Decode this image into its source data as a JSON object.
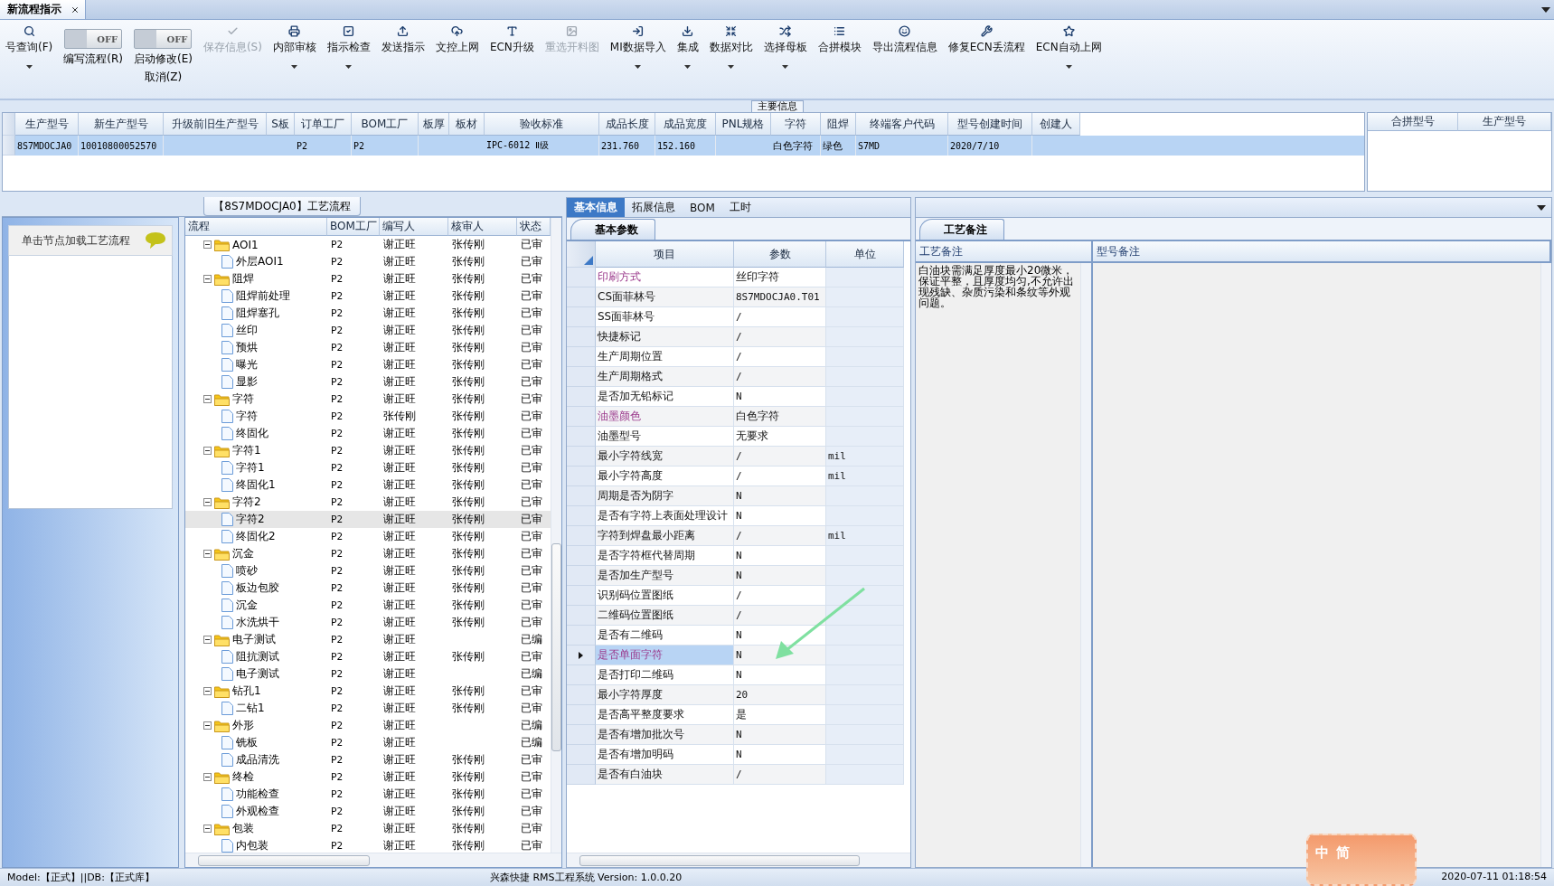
{
  "document_tabs": [
    {
      "label": "新流程指示",
      "selected": true
    }
  ],
  "toolbar": [
    {
      "kind": "button",
      "label": "号查询(F)",
      "disabled": false,
      "dropdown": true
    },
    {
      "kind": "toggle",
      "label": "编写流程(R)",
      "on": false,
      "state_text": "OFF"
    },
    {
      "kind": "toggle",
      "label": "启动修改(E)",
      "sublabel": "取消(Z)",
      "on": false,
      "state_text": "OFF"
    },
    {
      "kind": "button",
      "label": "保存信息(S)",
      "disabled": true,
      "dropdown": false
    },
    {
      "kind": "button",
      "label": "内部审核",
      "disabled": false,
      "dropdown": true
    },
    {
      "kind": "button",
      "label": "指示检查",
      "disabled": false,
      "dropdown": true
    },
    {
      "kind": "button",
      "label": "发送指示",
      "disabled": false,
      "dropdown": false
    },
    {
      "kind": "button",
      "label": "文控上网",
      "disabled": false,
      "dropdown": false
    },
    {
      "kind": "button",
      "label": "ECN升级",
      "disabled": false,
      "dropdown": false
    },
    {
      "kind": "button",
      "label": "重选开料图",
      "disabled": true,
      "dropdown": false
    },
    {
      "kind": "button",
      "label": "MI数据导入",
      "disabled": false,
      "dropdown": true
    },
    {
      "kind": "button",
      "label": "集成",
      "disabled": false,
      "dropdown": true
    },
    {
      "kind": "button",
      "label": "数据对比",
      "disabled": false,
      "dropdown": true
    },
    {
      "kind": "button",
      "label": "选择母板",
      "disabled": false,
      "dropdown": true
    },
    {
      "kind": "button",
      "label": "合拼模块",
      "disabled": false,
      "dropdown": false
    },
    {
      "kind": "button",
      "label": "导出流程信息",
      "disabled": false,
      "dropdown": false
    },
    {
      "kind": "button",
      "label": "修复ECN丢流程",
      "disabled": false,
      "dropdown": false
    },
    {
      "kind": "button",
      "label": "ECN自动上网",
      "disabled": false,
      "dropdown": true
    }
  ],
  "main_info": {
    "title": "主要信息",
    "columns": [
      "生产型号",
      "新生产型号",
      "升级前旧生产型号",
      "S板",
      "订单工厂",
      "BOM工厂",
      "板厚",
      "板材",
      "验收标准",
      "成品长度",
      "成品宽度",
      "PNL规格",
      "字符",
      "阻焊",
      "终端客户代码",
      "型号创建时间",
      "创建人"
    ],
    "rows": [
      {
        "selected": true,
        "cells": [
          "8S7MDOCJA0",
          "10010800052570",
          null,
          null,
          "P2",
          "P2",
          null,
          null,
          "IPC-6012 Ⅱ级",
          "231.760",
          "152.160",
          null,
          "白色字符",
          "绿色",
          "S7MD",
          "2020/7/10",
          null
        ]
      }
    ]
  },
  "merge_table": {
    "columns": [
      "合拼型号",
      "生产型号"
    ]
  },
  "flow_panel": {
    "title": "【8S7MDOCJA0】工艺流程",
    "hint": "单击节点加载工艺流程",
    "columns": [
      "流程",
      "BOM工厂",
      "编写人",
      "核审人",
      "状态"
    ],
    "nodes": [
      {
        "name": "AOI1",
        "factory": "P2",
        "writer": "谢正旺",
        "reviewer": "张传刚",
        "status": "已审",
        "expanded": true,
        "selected": false,
        "children": [
          {
            "name": "外层AOI1",
            "factory": "P2",
            "writer": "谢正旺",
            "reviewer": "张传刚",
            "status": "已审",
            "selected": false
          }
        ]
      },
      {
        "name": "阻焊",
        "factory": "P2",
        "writer": "谢正旺",
        "reviewer": "张传刚",
        "status": "已审",
        "expanded": true,
        "selected": false,
        "children": [
          {
            "name": "阻焊前处理",
            "factory": "P2",
            "writer": "谢正旺",
            "reviewer": "张传刚",
            "status": "已审",
            "selected": false
          },
          {
            "name": "阻焊塞孔",
            "factory": "P2",
            "writer": "谢正旺",
            "reviewer": "张传刚",
            "status": "已审",
            "selected": false
          },
          {
            "name": "丝印",
            "factory": "P2",
            "writer": "谢正旺",
            "reviewer": "张传刚",
            "status": "已审",
            "selected": false
          },
          {
            "name": "预烘",
            "factory": "P2",
            "writer": "谢正旺",
            "reviewer": "张传刚",
            "status": "已审",
            "selected": false
          },
          {
            "name": "曝光",
            "factory": "P2",
            "writer": "谢正旺",
            "reviewer": "张传刚",
            "status": "已审",
            "selected": false
          },
          {
            "name": "显影",
            "factory": "P2",
            "writer": "谢正旺",
            "reviewer": "张传刚",
            "status": "已审",
            "selected": false
          }
        ]
      },
      {
        "name": "字符",
        "factory": "P2",
        "writer": "谢正旺",
        "reviewer": "张传刚",
        "status": "已审",
        "expanded": true,
        "selected": false,
        "children": [
          {
            "name": "字符",
            "factory": "P2",
            "writer": "张传刚",
            "reviewer": "张传刚",
            "status": "已审",
            "selected": false
          },
          {
            "name": "终固化",
            "factory": "P2",
            "writer": "谢正旺",
            "reviewer": "张传刚",
            "status": "已审",
            "selected": false
          }
        ]
      },
      {
        "name": "字符1",
        "factory": "P2",
        "writer": "谢正旺",
        "reviewer": "张传刚",
        "status": "已审",
        "expanded": true,
        "selected": false,
        "children": [
          {
            "name": "字符1",
            "factory": "P2",
            "writer": "谢正旺",
            "reviewer": "张传刚",
            "status": "已审",
            "selected": false
          },
          {
            "name": "终固化1",
            "factory": "P2",
            "writer": "谢正旺",
            "reviewer": "张传刚",
            "status": "已审",
            "selected": false
          }
        ]
      },
      {
        "name": "字符2",
        "factory": "P2",
        "writer": "谢正旺",
        "reviewer": "张传刚",
        "status": "已审",
        "expanded": true,
        "selected": false,
        "children": [
          {
            "name": "字符2",
            "factory": "P2",
            "writer": "谢正旺",
            "reviewer": "张传刚",
            "status": "已审",
            "selected": true
          },
          {
            "name": "终固化2",
            "factory": "P2",
            "writer": "谢正旺",
            "reviewer": "张传刚",
            "status": "已审",
            "selected": false
          }
        ]
      },
      {
        "name": "沉金",
        "factory": "P2",
        "writer": "谢正旺",
        "reviewer": "张传刚",
        "status": "已审",
        "expanded": true,
        "selected": false,
        "children": [
          {
            "name": "喷砂",
            "factory": "P2",
            "writer": "谢正旺",
            "reviewer": "张传刚",
            "status": "已审",
            "selected": false
          },
          {
            "name": "板边包胶",
            "factory": "P2",
            "writer": "谢正旺",
            "reviewer": "张传刚",
            "status": "已审",
            "selected": false
          },
          {
            "name": "沉金",
            "factory": "P2",
            "writer": "谢正旺",
            "reviewer": "张传刚",
            "status": "已审",
            "selected": false
          },
          {
            "name": "水洗烘干",
            "factory": "P2",
            "writer": "谢正旺",
            "reviewer": "张传刚",
            "status": "已审",
            "selected": false
          }
        ]
      },
      {
        "name": "电子测试",
        "factory": "P2",
        "writer": "谢正旺",
        "status": "已编",
        "expanded": true,
        "selected": false,
        "children": [
          {
            "name": "阻抗测试",
            "factory": "P2",
            "writer": "谢正旺",
            "reviewer": "张传刚",
            "status": "已审",
            "selected": false
          },
          {
            "name": "电子测试",
            "factory": "P2",
            "writer": "谢正旺",
            "status": "已编",
            "selected": false
          }
        ]
      },
      {
        "name": "钻孔1",
        "factory": "P2",
        "writer": "谢正旺",
        "reviewer": "张传刚",
        "status": "已审",
        "expanded": true,
        "selected": false,
        "children": [
          {
            "name": "二钻1",
            "factory": "P2",
            "writer": "谢正旺",
            "reviewer": "张传刚",
            "status": "已审",
            "selected": false
          }
        ]
      },
      {
        "name": "外形",
        "factory": "P2",
        "writer": "谢正旺",
        "status": "已编",
        "expanded": true,
        "selected": false,
        "children": [
          {
            "name": "铣板",
            "factory": "P2",
            "writer": "谢正旺",
            "status": "已编",
            "selected": false
          },
          {
            "name": "成品清洗",
            "factory": "P2",
            "writer": "谢正旺",
            "reviewer": "张传刚",
            "status": "已审",
            "selected": false
          }
        ]
      },
      {
        "name": "终检",
        "factory": "P2",
        "writer": "谢正旺",
        "reviewer": "张传刚",
        "status": "已审",
        "expanded": true,
        "selected": false,
        "children": [
          {
            "name": "功能检查",
            "factory": "P2",
            "writer": "谢正旺",
            "reviewer": "张传刚",
            "status": "已审",
            "selected": false
          },
          {
            "name": "外观检查",
            "factory": "P2",
            "writer": "谢正旺",
            "reviewer": "张传刚",
            "status": "已审",
            "selected": false
          }
        ]
      },
      {
        "name": "包装",
        "factory": "P2",
        "writer": "谢正旺",
        "reviewer": "张传刚",
        "status": "已审",
        "expanded": true,
        "selected": false,
        "children": [
          {
            "name": "内包装",
            "factory": "P2",
            "writer": "谢正旺",
            "reviewer": "张传刚",
            "status": "已审",
            "selected": false
          }
        ]
      }
    ]
  },
  "detail_panel": {
    "tabs": [
      {
        "label": "基本信息",
        "selected": true
      },
      {
        "label": "拓展信息",
        "selected": false
      },
      {
        "label": "BOM",
        "selected": false
      },
      {
        "label": "工时",
        "selected": false
      }
    ],
    "subtab": "基本参数",
    "columns": [
      "项目",
      "参数",
      "单位"
    ],
    "rows": [
      {
        "item": "印刷方式",
        "value": "丝印字符",
        "emphasis": true,
        "selected": false
      },
      {
        "item": "CS面菲林号",
        "value": "8S7MDOCJA0.T01",
        "emphasis": false,
        "selected": false
      },
      {
        "item": "SS面菲林号",
        "value": "/",
        "emphasis": false,
        "selected": false
      },
      {
        "item": "快捷标记",
        "value": "/",
        "emphasis": false,
        "selected": false
      },
      {
        "item": "生产周期位置",
        "value": "/",
        "emphasis": false,
        "selected": false
      },
      {
        "item": "生产周期格式",
        "value": "/",
        "emphasis": false,
        "selected": false
      },
      {
        "item": "是否加无铅标记",
        "value": "N",
        "emphasis": false,
        "selected": false
      },
      {
        "item": "油墨颜色",
        "value": "白色字符",
        "emphasis": true,
        "selected": false
      },
      {
        "item": "油墨型号",
        "value": "无要求",
        "emphasis": false,
        "selected": false
      },
      {
        "item": "最小字符线宽",
        "value": "/",
        "unit": "mil",
        "emphasis": false,
        "selected": false
      },
      {
        "item": "最小字符高度",
        "value": "/",
        "unit": "mil",
        "emphasis": false,
        "selected": false
      },
      {
        "item": "周期是否为阴字",
        "value": "N",
        "emphasis": false,
        "selected": false
      },
      {
        "item": "是否有字符上表面处理设计",
        "value": "N",
        "emphasis": false,
        "selected": false
      },
      {
        "item": "字符到焊盘最小距离",
        "value": "/",
        "unit": "mil",
        "emphasis": false,
        "selected": false
      },
      {
        "item": "是否字符框代替周期",
        "value": "N",
        "emphasis": false,
        "selected": false
      },
      {
        "item": "是否加生产型号",
        "value": "N",
        "emphasis": false,
        "selected": false
      },
      {
        "item": "识别码位置图纸",
        "value": "/",
        "emphasis": false,
        "selected": false
      },
      {
        "item": "二维码位置图纸",
        "value": "/",
        "emphasis": false,
        "selected": false
      },
      {
        "item": "是否有二维码",
        "value": "N",
        "emphasis": false,
        "selected": false
      },
      {
        "item": "是否单面字符",
        "value": "N",
        "emphasis": true,
        "selected": true
      },
      {
        "item": "是否打印二维码",
        "value": "N",
        "emphasis": false,
        "selected": false
      },
      {
        "item": "最小字符厚度",
        "value": "20",
        "emphasis": false,
        "selected": false
      },
      {
        "item": "是否高平整度要求",
        "value": "是",
        "emphasis": false,
        "selected": false
      },
      {
        "item": "是否有增加批次号",
        "value": "N",
        "emphasis": false,
        "selected": false
      },
      {
        "item": "是否有增加明码",
        "value": "N",
        "emphasis": false,
        "selected": false
      },
      {
        "item": "是否有白油块",
        "value": "/",
        "emphasis": false,
        "selected": false
      }
    ]
  },
  "notes_panel": {
    "subtab": "工艺备注",
    "columns": [
      "工艺备注",
      "型号备注"
    ],
    "process_note": "白油块需满足厚度最小20微米，保证平整，且厚度均匀,不允许出现残缺、杂质污染和条纹等外观问题。"
  },
  "ime_badge": {
    "labels": [
      "中",
      "简"
    ]
  },
  "status_bar": {
    "left": "Model:【正式】||DB:【正式库】",
    "center": "兴森快捷 RMS工程系统 Version: 1.0.0.20",
    "right": "2020-07-11 01:18:54"
  }
}
